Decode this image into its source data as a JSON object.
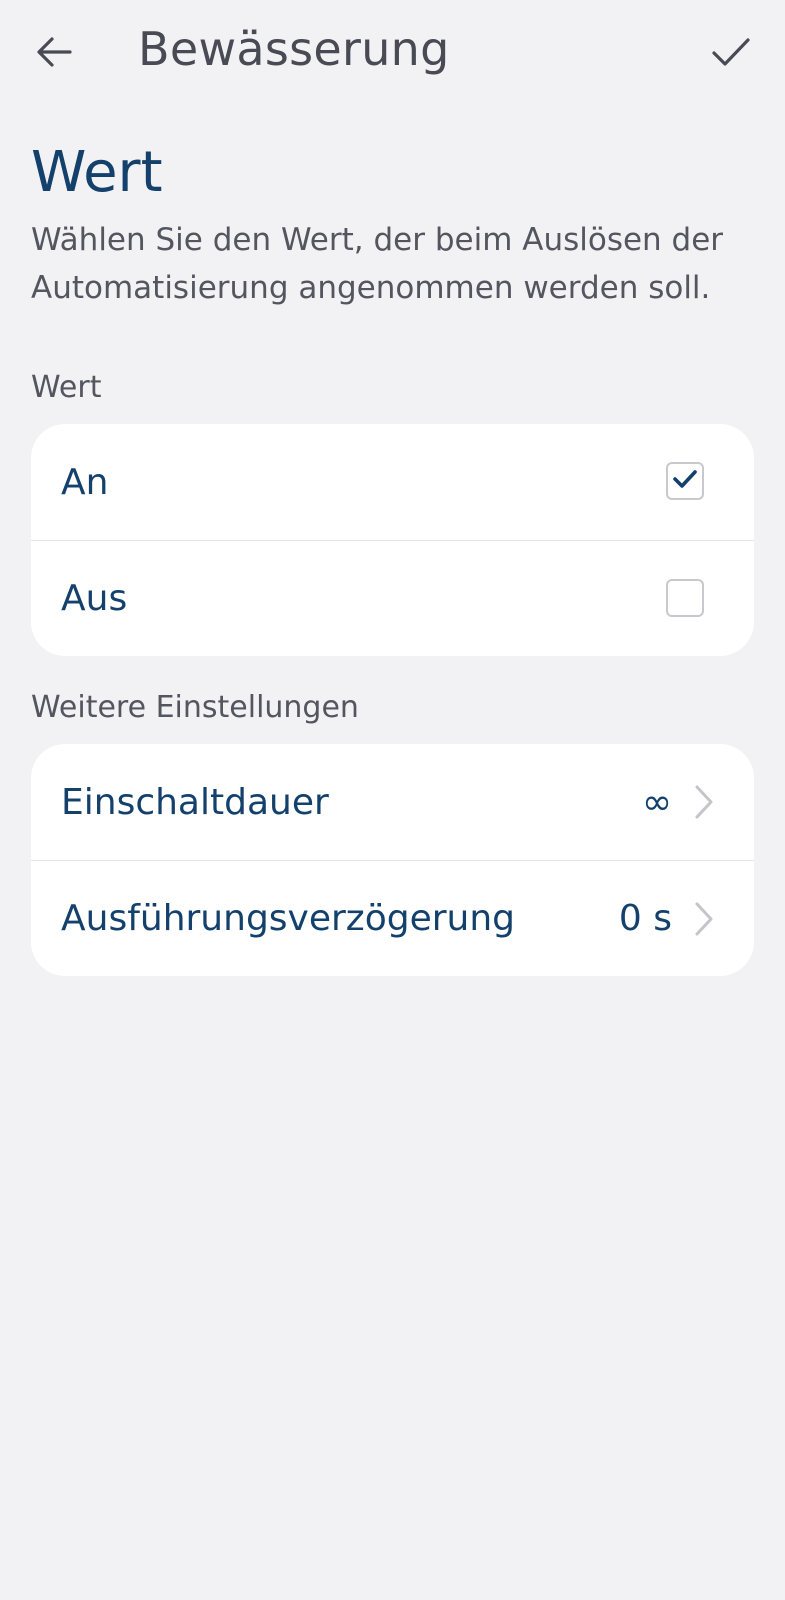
{
  "header": {
    "title": "Bewässerung",
    "back_icon": "arrow-left-icon",
    "confirm_icon": "checkmark-icon"
  },
  "intro": {
    "title": "Wert",
    "description": "Wählen Sie den Wert, der beim Auslösen der Automatisierung angenommen werden soll."
  },
  "value_section": {
    "label": "Wert",
    "options": [
      {
        "label": "An",
        "checked": true
      },
      {
        "label": "Aus",
        "checked": false
      }
    ]
  },
  "settings_section": {
    "label": "Weitere Einstellungen",
    "items": [
      {
        "label": "Einschaltdauer",
        "value": "∞"
      },
      {
        "label": "Ausführungsverzögerung",
        "value": "0 s"
      }
    ]
  },
  "colors": {
    "background": "#f2f2f5",
    "accent": "#14406c",
    "text_secondary": "#55555f",
    "card": "#ffffff"
  }
}
